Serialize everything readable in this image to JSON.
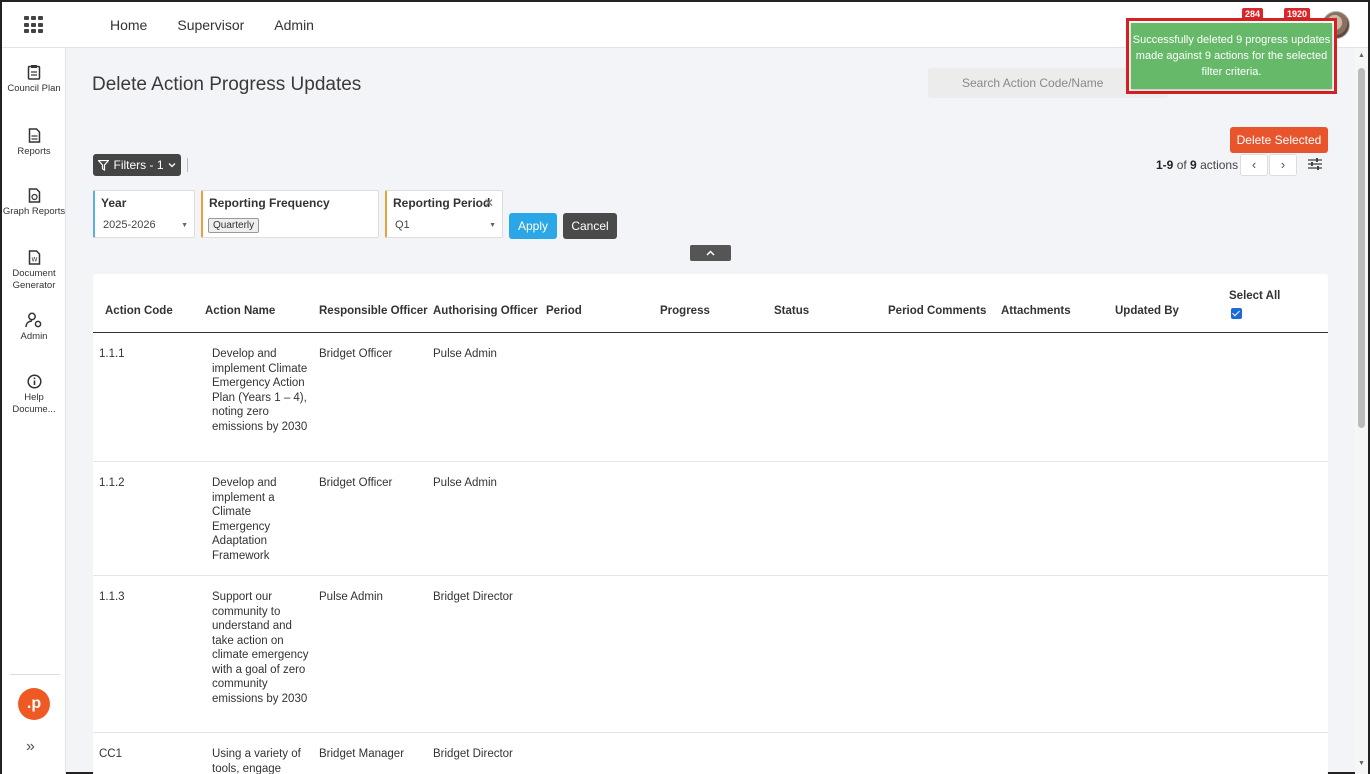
{
  "topnav": {
    "home": "Home",
    "supervisor": "Supervisor",
    "admin": "Admin",
    "badge1": "284",
    "badge2": "1920"
  },
  "sidebar": {
    "items": [
      {
        "label": "Council Plan"
      },
      {
        "label": "Reports"
      },
      {
        "label": "Graph Reports"
      },
      {
        "label": "Document Generator"
      },
      {
        "label": "Admin"
      },
      {
        "label": "Help Docume..."
      }
    ],
    "logo": ".p",
    "expand": "»"
  },
  "page": {
    "title": "Delete Action Progress Updates",
    "search_placeholder": "Search Action Code/Name",
    "toast": "Successfully deleted 9 progress updates made against 9 actions for the selected filter criteria.",
    "delete_selected": "Delete Selected",
    "filters_label": "Filters - 1",
    "pager_range": "1-9",
    "pager_of": "of",
    "pager_total": "9",
    "pager_suffix": "actions"
  },
  "filters": {
    "year": {
      "label": "Year",
      "value": "2025-2026"
    },
    "frequency": {
      "label": "Reporting Frequency",
      "chip": "Quarterly"
    },
    "period": {
      "label": "Reporting Period",
      "value": "Q1"
    },
    "apply": "Apply",
    "cancel": "Cancel"
  },
  "table": {
    "headers": {
      "code": "Action Code",
      "name": "Action Name",
      "resp": "Responsible Officer",
      "auth": "Authorising Officer",
      "period": "Period",
      "progress": "Progress",
      "status": "Status",
      "comments": "Period Comments",
      "attachments": "Attachments",
      "updated": "Updated By",
      "select_all": "Select All"
    },
    "rows": [
      {
        "code": "1.1.1",
        "name": "Develop and implement Climate Emergency Action Plan (Years 1 – 4), noting zero emissions by 2030",
        "resp": "Bridget Officer",
        "auth": "Pulse Admin"
      },
      {
        "code": "1.1.2",
        "name": "Develop and implement a Climate Emergency Adaptation Framework",
        "resp": "Bridget Officer",
        "auth": "Pulse Admin"
      },
      {
        "code": "1.1.3",
        "name": "Support our community to understand and take action on climate emergency with a goal of zero community emissions by 2030",
        "resp": "Pulse Admin",
        "auth": "Bridget Director"
      },
      {
        "code": "CC1",
        "name": "Using a variety of tools, engage",
        "resp": "Bridget Manager",
        "auth": "Bridget Director"
      }
    ]
  }
}
